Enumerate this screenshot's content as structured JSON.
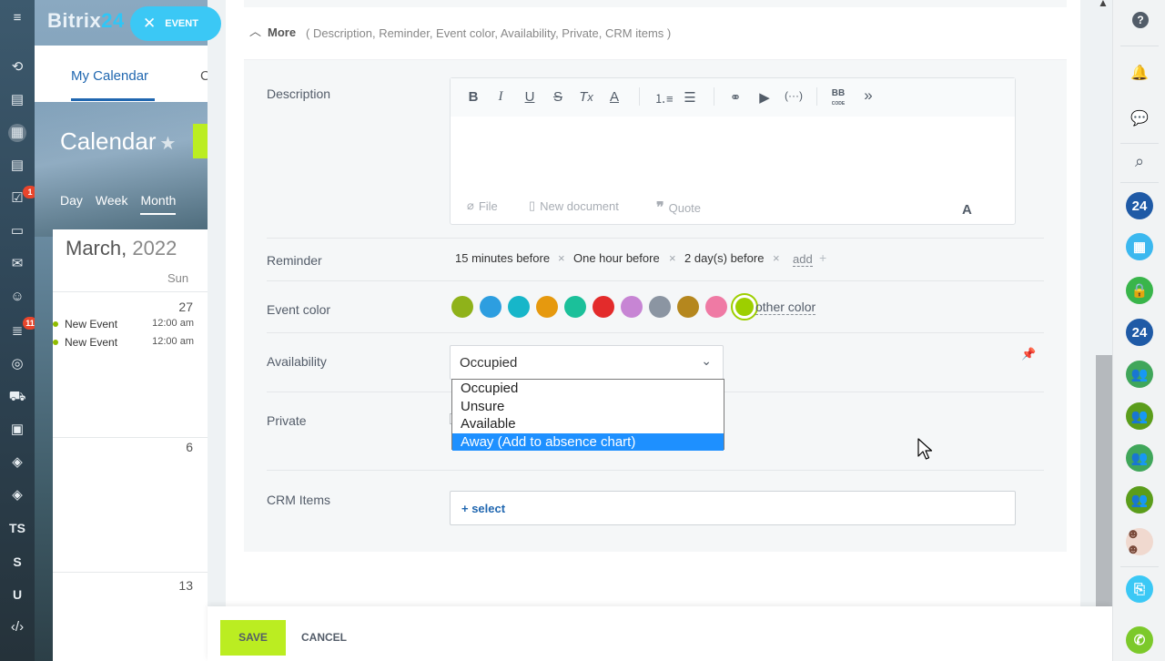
{
  "background_app": {
    "logo_text": "Bitrix",
    "logo_suffix": "24",
    "event_pill_label": "EVENT",
    "tabs": [
      "My Calendar",
      "C"
    ],
    "calendar_title": "Calendar",
    "views": [
      "Day",
      "Week",
      "Month"
    ],
    "month_name": "March,",
    "month_year": "2022",
    "day_of_week": "Sun",
    "days": [
      "27",
      "6",
      "13"
    ],
    "events": [
      {
        "title": "New Event",
        "time": "12:00 am"
      },
      {
        "title": "New Event",
        "time": "12:00 am"
      }
    ],
    "left_nav": {
      "tasks_badge": "1",
      "feed_badge": "11",
      "text_items": [
        "TS",
        "S",
        "U"
      ]
    }
  },
  "more": {
    "label": "More",
    "hint": "( Description,  Reminder,  Event color,  Availability,  Private,  CRM items )"
  },
  "form": {
    "description_label": "Description",
    "editor_footer": {
      "file": "File",
      "new_document": "New document",
      "quote": "Quote",
      "font_toggle": "A"
    },
    "toolbar": {
      "bb_code": "BB"
    },
    "reminder_label": "Reminder",
    "reminders": [
      "15 minutes before",
      "One hour before",
      "2 day(s) before"
    ],
    "reminder_add": "add",
    "event_color_label": "Event color",
    "colors": [
      "#8fb21a",
      "#2d9ee0",
      "#17b6c9",
      "#e6990e",
      "#1bc09a",
      "#e32b2b",
      "#c785d4",
      "#8b95a2",
      "#b5871e",
      "#ef7aa4",
      "#9dcf00"
    ],
    "selected_color": "#9dcf00",
    "other_color": "other color",
    "availability_label": "Availability",
    "availability_value": "Occupied",
    "availability_options": [
      "Occupied",
      "Unsure",
      "Available",
      "Away (Add to absence chart)"
    ],
    "highlighted_option": "Away (Add to absence chart)",
    "private_label": "Private",
    "crm_label": "CRM Items",
    "crm_select": "+  select"
  },
  "footer": {
    "save": "SAVE",
    "cancel": "CANCEL"
  },
  "right_bar": {
    "help": "?",
    "b24_1": "24",
    "b24_2": "24"
  }
}
